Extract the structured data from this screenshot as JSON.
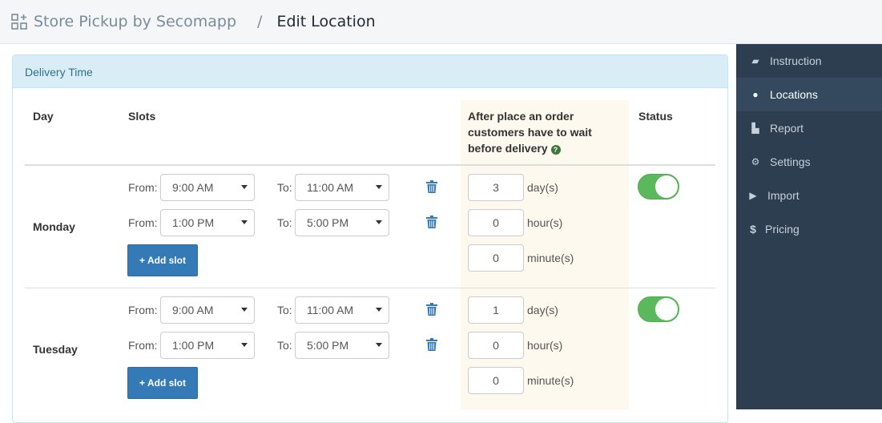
{
  "header": {
    "app_name": "Store Pickup by Secomapp",
    "separator": "/",
    "page_title": "Edit Location",
    "icon": "apps-add-icon"
  },
  "sidebar": {
    "items": [
      {
        "label": "Instruction",
        "icon": "book-icon",
        "active": false
      },
      {
        "label": "Locations",
        "icon": "map-marker-icon",
        "active": true
      },
      {
        "label": "Report",
        "icon": "bar-chart-icon",
        "active": false
      },
      {
        "label": "Settings",
        "icon": "gear-icon",
        "active": false
      },
      {
        "label": "Import",
        "icon": "folder-open-icon",
        "active": false
      },
      {
        "label": "Pricing",
        "icon": "dollar-icon",
        "active": false
      }
    ]
  },
  "panel": {
    "title": "Delivery Time"
  },
  "table": {
    "headers": {
      "day": "Day",
      "slots": "Slots",
      "wait": "After place an order customers have to wait before delivery",
      "status": "Status"
    },
    "labels": {
      "from": "From:",
      "to": "To:",
      "add_slot": "+ Add slot",
      "days_unit": "day(s)",
      "hours_unit": "hour(s)",
      "minutes_unit": "minute(s)"
    },
    "rows": [
      {
        "day": "Monday",
        "slots": [
          {
            "from": "9:00 AM",
            "to": "11:00 AM"
          },
          {
            "from": "1:00 PM",
            "to": "5:00 PM"
          }
        ],
        "wait": {
          "days": "3",
          "hours": "0",
          "minutes": "0"
        },
        "status": true
      },
      {
        "day": "Tuesday",
        "slots": [
          {
            "from": "9:00 AM",
            "to": "11:00 AM"
          },
          {
            "from": "1:00 PM",
            "to": "5:00 PM"
          }
        ],
        "wait": {
          "days": "1",
          "hours": "0",
          "minutes": "0"
        },
        "status": true
      }
    ]
  },
  "colors": {
    "sidebar": "#2c3e50",
    "sidebar_active": "#34495e",
    "panel_header": "#d9edf7",
    "primary": "#337ab7",
    "toggle_on": "#5cb85c",
    "highlight_col": "#fdf9ee",
    "help_icon": "#3c763d"
  }
}
